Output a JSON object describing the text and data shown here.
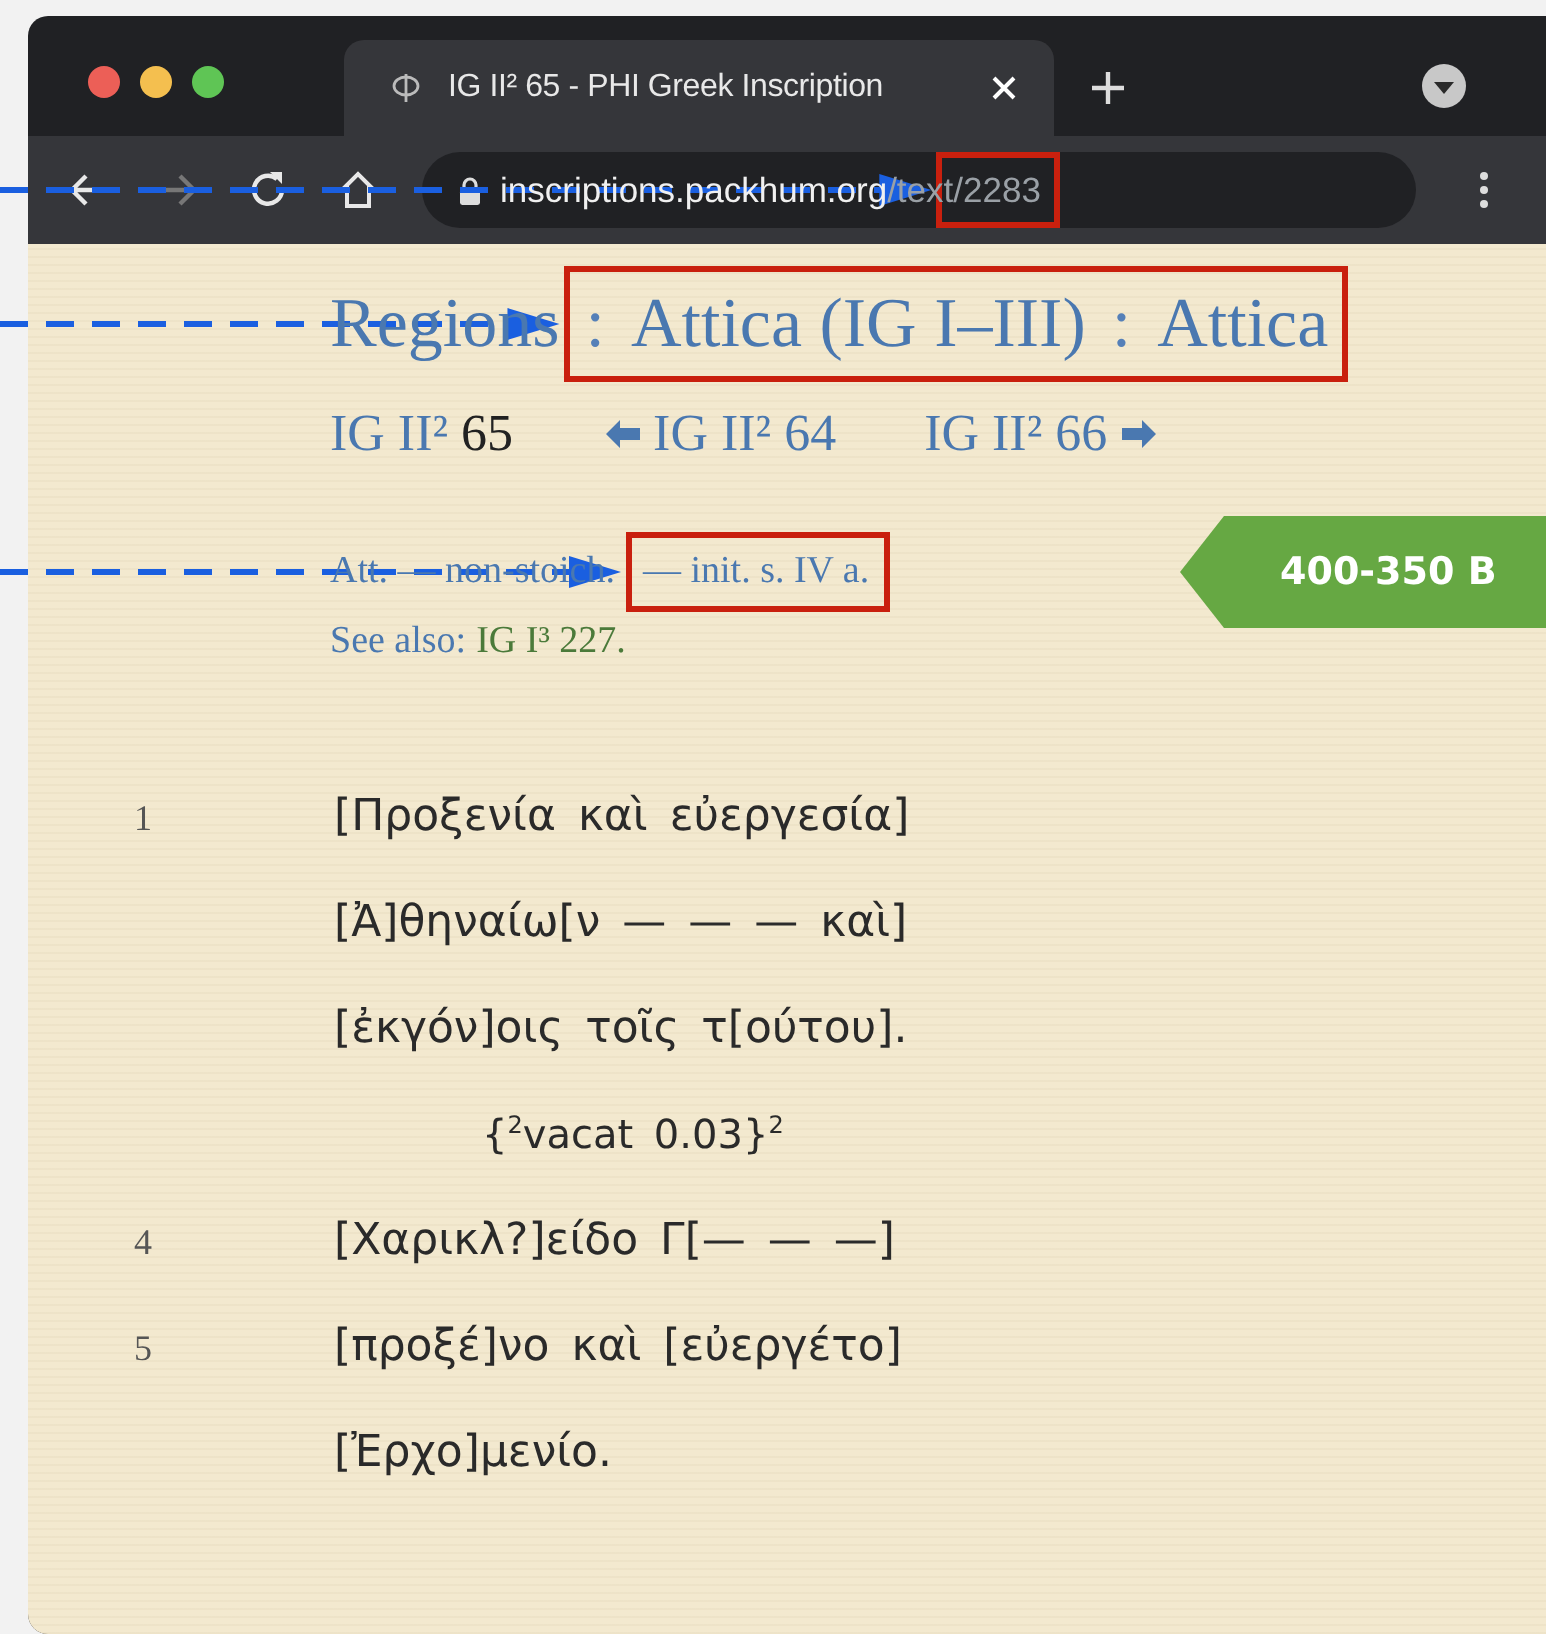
{
  "browser": {
    "tab": {
      "title": "IG II² 65 - PHI Greek Inscription",
      "selected": true
    },
    "address": [
      {
        "kind": "host",
        "text": "inscriptions.packhum.org",
        "highlighted": false
      },
      {
        "kind": "path",
        "text": "/text",
        "highlighted": false
      },
      {
        "kind": "path",
        "text": "/2283",
        "highlighted": true
      }
    ]
  },
  "page": {
    "breadcrumb": [
      {
        "kind": "link",
        "text": "Regions",
        "highlighted": false
      },
      {
        "kind": "sep",
        "text": ":",
        "highlighted": true
      },
      {
        "kind": "link",
        "text": "Attica (IG I–III)",
        "highlighted": true
      },
      {
        "kind": "sep",
        "text": ":",
        "highlighted": true
      },
      {
        "kind": "link",
        "text": "Attica",
        "highlighted": true
      }
    ],
    "nav": {
      "current_prefix": "IG II²",
      "current_number": "65",
      "prev": "IG II² 64",
      "next": "IG II² 66"
    },
    "meta": [
      {
        "text": "Att. — non-stoich.",
        "highlighted": false
      },
      {
        "text": "— init. s. IV a.",
        "highlighted": true
      }
    ],
    "date_badge": "400-350 B",
    "see_also": {
      "label": "See also:",
      "link": "IG I³ 227."
    },
    "inscription": [
      {
        "kind": "line",
        "number": "1",
        "text": "[Προξενία καὶ εὐεργεσία]"
      },
      {
        "kind": "line",
        "text": "[Ἀ]θηναίω[ν — — — καὶ]"
      },
      {
        "kind": "line",
        "text": "[ἐκγόν]οις τοῖς τ[ούτου]."
      },
      {
        "kind": "vacat",
        "text": "{$^{2}$vacat  0.03}$^{2}$"
      },
      {
        "kind": "line",
        "number": "4",
        "text": "[Χαρικλ?]είδο Γ[— — —]"
      },
      {
        "kind": "line",
        "number": "5",
        "text": "[προξέ]νο καὶ [εὐεργέτο]"
      },
      {
        "kind": "line",
        "text": "[Ἐρχο]μενίο."
      }
    ]
  }
}
